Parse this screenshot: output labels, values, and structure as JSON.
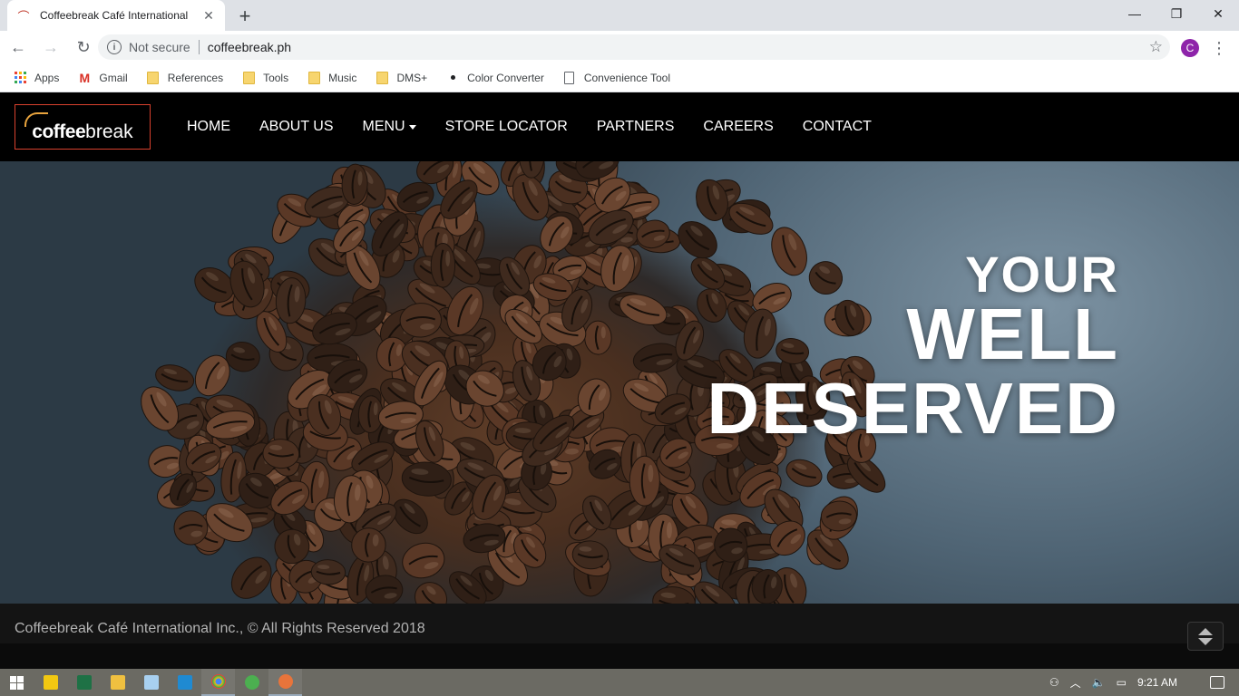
{
  "browser": {
    "tab_title": "Coffeebreak Café International",
    "new_tab_symbol": "+",
    "address": {
      "security_label": "Not secure",
      "url": "coffeebreak.ph"
    },
    "profile_initial": "C",
    "bookmarks": [
      {
        "label": "Apps",
        "icon": "apps-grid-icon"
      },
      {
        "label": "Gmail",
        "icon": "gmail-icon"
      },
      {
        "label": "References",
        "icon": "folder-icon"
      },
      {
        "label": "Tools",
        "icon": "folder-icon"
      },
      {
        "label": "Music",
        "icon": "folder-icon"
      },
      {
        "label": "DMS+",
        "icon": "folder-icon"
      },
      {
        "label": "Color Converter",
        "icon": "dot-icon"
      },
      {
        "label": "Convenience Tool",
        "icon": "page-icon"
      }
    ]
  },
  "site": {
    "logo": {
      "part1": "coffee",
      "part2": "break"
    },
    "nav": [
      "HOME",
      "ABOUT US",
      "MENU",
      "STORE LOCATOR",
      "PARTNERS",
      "CAREERS",
      "CONTACT"
    ],
    "hero": {
      "line1": "YOUR",
      "line2": "WELL",
      "line3": "DESERVED"
    },
    "footer": {
      "copyright": "Coffeebreak Café International Inc., © All Rights Reserved 2018"
    }
  },
  "taskbar": {
    "clock": "9:21 AM"
  },
  "colors": {
    "header_bg": "#000000",
    "logo_border": "#d9412e",
    "nav_text": "#ffffff",
    "footer_text": "#b3b3b3"
  }
}
